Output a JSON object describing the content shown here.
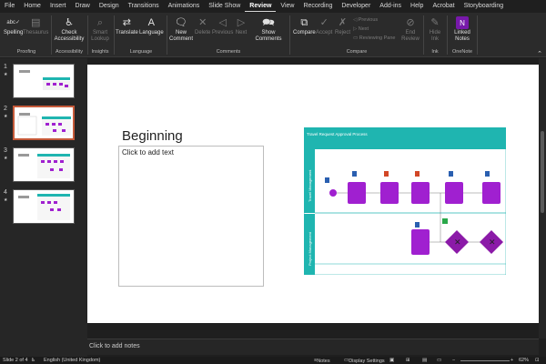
{
  "tabs": [
    "File",
    "Home",
    "Insert",
    "Draw",
    "Design",
    "Transitions",
    "Animations",
    "Slide Show",
    "Review",
    "View",
    "Recording",
    "Developer",
    "Add-ins",
    "Help",
    "Acrobat",
    "Storyboarding"
  ],
  "active_tab": "Review",
  "ribbon": {
    "spelling": "Spelling",
    "thesaurus": "Thesaurus",
    "proofing_group": "Proofing",
    "check_accessibility_1": "Check",
    "check_accessibility_2": "Accessibility",
    "accessibility_group": "Accessibility",
    "smart_lookup_1": "Smart",
    "smart_lookup_2": "Lookup",
    "insights_group": "Insights",
    "translate": "Translate",
    "language": "Language",
    "language_group": "Language",
    "new_comment_1": "New",
    "new_comment_2": "Comment",
    "delete": "Delete",
    "previous": "Previous",
    "next": "Next",
    "show_comments_1": "Show",
    "show_comments_2": "Comments",
    "comments_group": "Comments",
    "compare": "Compare",
    "accept": "Accept",
    "reject": "Reject",
    "cmp_previous": "Previous",
    "cmp_next": "Next",
    "reviewing_pane": "Reviewing Pane",
    "end_review_1": "End",
    "end_review_2": "Review",
    "compare_group": "Compare",
    "hide_ink_1": "Hide",
    "hide_ink_2": "Ink",
    "ink_group": "Ink",
    "linked_notes_1": "Linked",
    "linked_notes_2": "Notes",
    "onenote_group": "OneNote"
  },
  "thumbnails": [
    {
      "num": "1",
      "star": "★"
    },
    {
      "num": "2",
      "star": "★"
    },
    {
      "num": "3",
      "star": "★"
    },
    {
      "num": "4",
      "star": "★"
    }
  ],
  "slide": {
    "title": "Beginning",
    "body_placeholder": "Click to add text",
    "diagram_title": "Travel Request Approval Process",
    "lane1": "Travel Management",
    "lane2": "Project Management"
  },
  "notes_placeholder": "Click to add notes",
  "status": {
    "slide": "Slide 2 of 4",
    "language": "English (United Kingdom)",
    "notes": "Notes",
    "display": "Display Settings",
    "zoom": "62%"
  },
  "colors": {
    "accent": "#1fb5b0",
    "node": "#a020d0",
    "diamond": "#8b1aa8",
    "selected": "#c55a3a"
  }
}
